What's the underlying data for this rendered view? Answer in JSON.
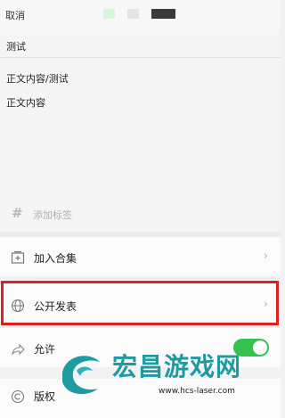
{
  "topbar": {
    "cancel_label": "取消"
  },
  "editor": {
    "title": "测试",
    "body_lines": [
      "正文内容/测试",
      "正文内容"
    ],
    "tag_placeholder": "添加标签"
  },
  "settings": {
    "add_collection": "加入合集",
    "publish_public": "公开发表",
    "allow_label": "允许",
    "copyright": "版权"
  },
  "watermark": {
    "brand": "宏昌游戏网",
    "url": "www.hcs-laser.com"
  },
  "colors": {
    "highlight_border": "#e02020",
    "toggle_on": "#34c34e",
    "watermark": "#1f9aa0"
  }
}
